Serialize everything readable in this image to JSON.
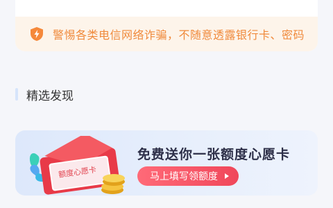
{
  "warning": {
    "icon": "lightning-shield-icon",
    "text": "警惕各类电信网络诈骗，不随意透露银行卡、密码"
  },
  "section": {
    "title": "精选发现"
  },
  "promo": {
    "title": "免费送你一张额度心愿卡",
    "button_label": "马上填写领额度",
    "card_label": "额度心愿卡",
    "art_icon": "red-envelope-coins-icon"
  },
  "colors": {
    "warning_text": "#f08a3c",
    "warning_bg": "#fdf4ea",
    "promo_button": "#f0475a",
    "page_bg": "#f5f6fa"
  }
}
